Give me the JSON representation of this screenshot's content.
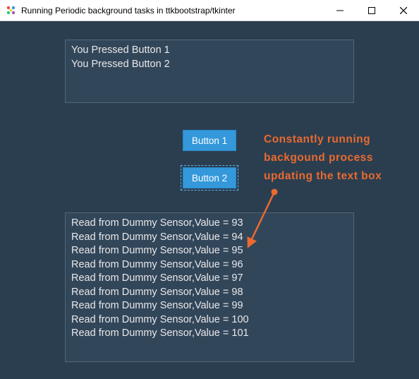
{
  "window": {
    "title": "Running Periodic background tasks in ttkbootstrap/tkinter"
  },
  "upper_textbox_content": "You Pressed Button 1\nYou Pressed Button 2",
  "buttons": {
    "button1_label": "Button 1",
    "button2_label": "Button 2"
  },
  "lower_textbox_lines": [
    "Read from Dummy Sensor,Value = 93",
    "Read from Dummy Sensor,Value = 94",
    "Read from Dummy Sensor,Value = 95",
    "Read from Dummy Sensor,Value = 96",
    "Read from Dummy Sensor,Value = 97",
    "Read from Dummy Sensor,Value = 98",
    "Read from Dummy Sensor,Value = 99",
    "Read from Dummy Sensor,Value = 100",
    "Read from Dummy Sensor,Value = 101"
  ],
  "annotation_text": "Constantly running backgound process updating the text box",
  "colors": {
    "client_bg": "#2b3e50",
    "textbox_bg": "#32465a",
    "button_bg": "#3498db",
    "annotation_color": "#ea6a2f"
  }
}
